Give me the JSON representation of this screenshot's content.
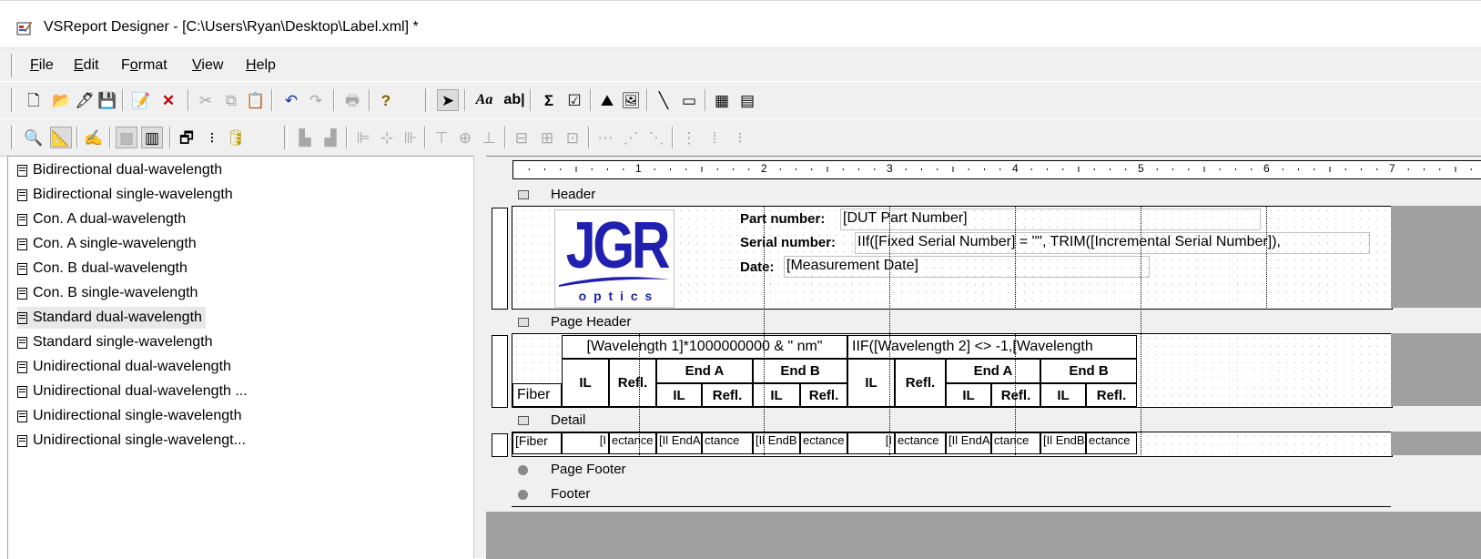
{
  "window": {
    "title": "VSReport Designer - [C:\\Users\\Ryan\\Desktop\\Label.xml] *"
  },
  "menu": [
    {
      "label": "File",
      "accel": "F",
      "rest": "ile"
    },
    {
      "label": "Edit",
      "accel": "E",
      "rest": "dit"
    },
    {
      "label": "Format",
      "accel": "o",
      "pre": "F",
      "rest": "rmat"
    },
    {
      "label": "View",
      "accel": "V",
      "rest": "iew"
    },
    {
      "label": "Help",
      "accel": "H",
      "rest": "elp"
    }
  ],
  "reports": [
    "Bidirectional dual-wavelength",
    "Bidirectional single-wavelength",
    "Con. A dual-wavelength",
    "Con. A single-wavelength",
    "Con. B dual-wavelength",
    "Con. B single-wavelength",
    "Standard dual-wavelength",
    "Standard single-wavelength",
    "Unidirectional dual-wavelength",
    "Unidirectional dual-wavelength ...",
    "Unidirectional single-wavelength",
    "Unidirectional single-wavelengt..."
  ],
  "selected_report": "Standard dual-wavelength",
  "ruler": [
    "1",
    "2",
    "3",
    "4",
    "5",
    "6",
    "7"
  ],
  "bands": {
    "header": "Header",
    "page_header": "Page Header",
    "detail": "Detail",
    "page_footer": "Page Footer",
    "footer": "Footer"
  },
  "logo": {
    "big": "JGR",
    "small": "o p t i c s",
    "color": "#2020b0"
  },
  "header_fields": {
    "part_label": "Part number:",
    "part_value": "[DUT Part Number]",
    "serial_label": "Serial number:",
    "serial_value": "IIf([Fixed Serial Number] = \"\", TRIM([Incremental Serial Number]),",
    "date_label": "Date:",
    "date_value": "[Measurement Date]"
  },
  "page_header": {
    "wl1": "[Wavelength 1]*1000000000 & \" nm\"",
    "wl2": "IIF([Wavelength 2] <> -1,[Wavelength",
    "fiber": "Fiber",
    "il": "IL",
    "refl": "Refl.",
    "end_a": "End A",
    "end_b": "End B"
  },
  "detail": {
    "fiber": "[Fiber",
    "c1": "[I",
    "c2": "ectance",
    "c3": "[Il EndA",
    "c4": "ctance",
    "c5": "[Il EndB",
    "c6": "ectance",
    "c7": "[I",
    "c8": "ectance",
    "c9": "[Il EndA",
    "c10": "ctance",
    "c11": "[Il EndB",
    "c12": "ectance"
  }
}
